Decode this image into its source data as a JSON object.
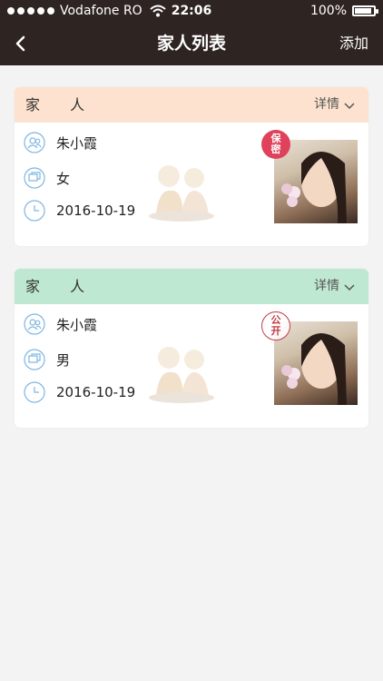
{
  "status_bar": {
    "carrier": "Vodafone RO",
    "time": "22:06",
    "battery": "100%",
    "battery_level": 1.0
  },
  "nav": {
    "title": "家人列表",
    "add_label": "添加"
  },
  "cards": [
    {
      "header": "家 人",
      "header_color": "#fde3cf",
      "detail_label": "详情",
      "name": "朱小霞",
      "gender": "女",
      "date": "2016-10-19",
      "stamp": "保密",
      "stamp_color": "#e0425b"
    },
    {
      "header": "家 人",
      "header_color": "#bfe8d2",
      "detail_label": "详情",
      "name": "朱小霞",
      "gender": "男",
      "date": "2016-10-19",
      "stamp": "公开",
      "stamp_color": "#c23a47"
    }
  ],
  "icons": [
    "back-chevron-icon",
    "users-icon",
    "chat-icon",
    "clock-icon",
    "chevron-down-icon",
    "wifi-icon",
    "battery-icon"
  ]
}
